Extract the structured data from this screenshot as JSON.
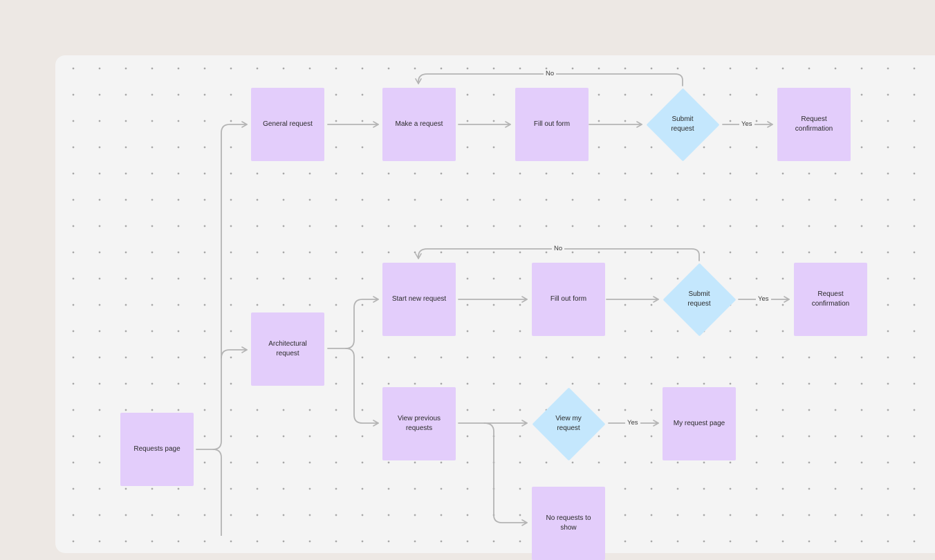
{
  "nodes": {
    "requests_page": "Requests page",
    "general_request": "General request",
    "make_request": "Make a request",
    "fill_form_1": "Fill out form",
    "submit_request_1": "Submit request",
    "request_confirmation_1": "Request confirmation",
    "architectural_request": "Architectural request",
    "start_new_request": "Start new request",
    "fill_form_2": "Fill out form",
    "submit_request_2": "Submit request",
    "request_confirmation_2": "Request confirmation",
    "view_previous_requests": "View previous requests",
    "view_my_request": "View my request",
    "my_request_page": "My request page",
    "no_requests": "No requests to show"
  },
  "edge_labels": {
    "no_1": "No",
    "yes_1": "Yes",
    "no_2": "No",
    "yes_2": "Yes",
    "yes_3": "Yes"
  },
  "colors": {
    "process_node": "#e3cdfb",
    "decision_node": "#c4e7fd",
    "connector": "#b4b4b4",
    "canvas": "#f4f4f4",
    "frame": "#ede8e4"
  }
}
